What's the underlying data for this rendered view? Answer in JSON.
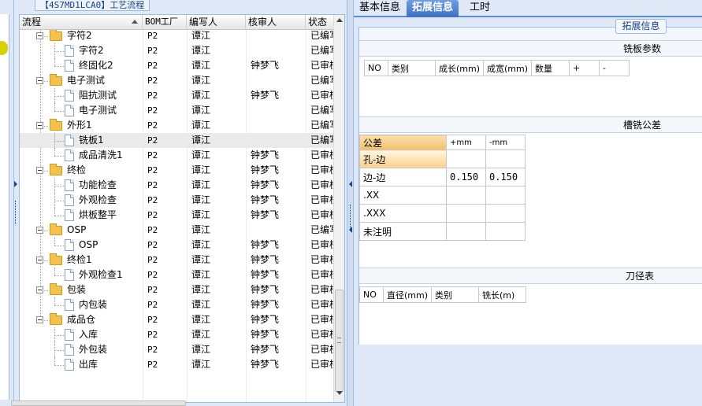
{
  "left_panel": {
    "title": "【4S7MD1LCA0】工艺流程",
    "columns": [
      "流程",
      "BOM工厂",
      "编写人",
      "核审人",
      "状态"
    ],
    "rows": [
      {
        "level": 1,
        "type": "folder",
        "name": "字符2",
        "factory": "P2",
        "writer": "谭江",
        "reviewer": "",
        "status": "已编写"
      },
      {
        "level": 2,
        "type": "file",
        "name": "字符2",
        "factory": "P2",
        "writer": "谭江",
        "reviewer": "",
        "status": "已编写"
      },
      {
        "level": 2,
        "type": "file",
        "name": "终固化2",
        "factory": "P2",
        "writer": "谭江",
        "reviewer": "钟梦飞",
        "status": "已审核"
      },
      {
        "level": 1,
        "type": "folder",
        "name": "电子测试",
        "factory": "P2",
        "writer": "谭江",
        "reviewer": "",
        "status": "已编写"
      },
      {
        "level": 2,
        "type": "file",
        "name": "阻抗测试",
        "factory": "P2",
        "writer": "谭江",
        "reviewer": "钟梦飞",
        "status": "已审核"
      },
      {
        "level": 2,
        "type": "file",
        "name": "电子测试",
        "factory": "P2",
        "writer": "谭江",
        "reviewer": "",
        "status": "已编写"
      },
      {
        "level": 1,
        "type": "folder",
        "name": "外形1",
        "factory": "P2",
        "writer": "谭江",
        "reviewer": "",
        "status": "已编写"
      },
      {
        "level": 2,
        "type": "file",
        "name": "铣板1",
        "factory": "P2",
        "writer": "谭江",
        "reviewer": "",
        "status": "已编写",
        "selected": true
      },
      {
        "level": 2,
        "type": "file",
        "name": "成品清洗1",
        "factory": "P2",
        "writer": "谭江",
        "reviewer": "钟梦飞",
        "status": "已审核"
      },
      {
        "level": 1,
        "type": "folder",
        "name": "终检",
        "factory": "P2",
        "writer": "谭江",
        "reviewer": "钟梦飞",
        "status": "已审核"
      },
      {
        "level": 2,
        "type": "file",
        "name": "功能检查",
        "factory": "P2",
        "writer": "谭江",
        "reviewer": "钟梦飞",
        "status": "已审核"
      },
      {
        "level": 2,
        "type": "file",
        "name": "外观检查",
        "factory": "P2",
        "writer": "谭江",
        "reviewer": "钟梦飞",
        "status": "已审核"
      },
      {
        "level": 2,
        "type": "file",
        "name": "烘板整平",
        "factory": "P2",
        "writer": "谭江",
        "reviewer": "钟梦飞",
        "status": "已审核"
      },
      {
        "level": 1,
        "type": "folder",
        "name": "OSP",
        "factory": "P2",
        "writer": "谭江",
        "reviewer": "",
        "status": "已编写"
      },
      {
        "level": 2,
        "type": "file",
        "name": "OSP",
        "factory": "P2",
        "writer": "谭江",
        "reviewer": "钟梦飞",
        "status": "已审核"
      },
      {
        "level": 1,
        "type": "folder",
        "name": "终检1",
        "factory": "P2",
        "writer": "谭江",
        "reviewer": "钟梦飞",
        "status": "已审核"
      },
      {
        "level": 2,
        "type": "file",
        "name": "外观检查1",
        "factory": "P2",
        "writer": "谭江",
        "reviewer": "钟梦飞",
        "status": "已审核"
      },
      {
        "level": 1,
        "type": "folder",
        "name": "包装",
        "factory": "P2",
        "writer": "谭江",
        "reviewer": "钟梦飞",
        "status": "已审核"
      },
      {
        "level": 2,
        "type": "file",
        "name": "内包装",
        "factory": "P2",
        "writer": "谭江",
        "reviewer": "钟梦飞",
        "status": "已审核"
      },
      {
        "level": 1,
        "type": "folder",
        "name": "成品仓",
        "factory": "P2",
        "writer": "谭江",
        "reviewer": "钟梦飞",
        "status": "已审核"
      },
      {
        "level": 2,
        "type": "file",
        "name": "入库",
        "factory": "P2",
        "writer": "谭江",
        "reviewer": "钟梦飞",
        "status": "已审核"
      },
      {
        "level": 2,
        "type": "file",
        "name": "外包装",
        "factory": "P2",
        "writer": "谭江",
        "reviewer": "钟梦飞",
        "status": "已审核"
      },
      {
        "level": 2,
        "type": "file",
        "name": "出库",
        "factory": "P2",
        "writer": "谭江",
        "reviewer": "钟梦飞",
        "status": "已审核"
      }
    ]
  },
  "tabs": {
    "basic": "基本信息",
    "extended": "拓展信息",
    "hours": "工时"
  },
  "extended": {
    "title": "拓展信息",
    "mill_params": {
      "title": "铣板参数",
      "headers": [
        "NO",
        "类别",
        "成长(mm)",
        "成宽(mm)",
        "数量",
        "+",
        "-"
      ]
    },
    "slot_tolerance": {
      "title": "槽铣公差",
      "headers": [
        "公差",
        "+mm",
        "-mm"
      ],
      "rows": [
        {
          "label": "孔-边",
          "plus": "",
          "minus": ""
        },
        {
          "label": "边-边",
          "plus": "0.150",
          "minus": "0.150"
        },
        {
          "label": ".XX",
          "plus": "",
          "minus": ""
        },
        {
          "label": ".XXX",
          "plus": "",
          "minus": ""
        },
        {
          "label": "未注明",
          "plus": "",
          "minus": ""
        }
      ]
    },
    "tool_table": {
      "title": "刀径表",
      "headers": [
        "NO",
        "直径(mm)",
        "类别",
        "铣长(m)"
      ]
    }
  },
  "colors": {
    "accent": "#3e6fc4",
    "border": "#99bbe8",
    "highlight": "#f3c06b"
  }
}
